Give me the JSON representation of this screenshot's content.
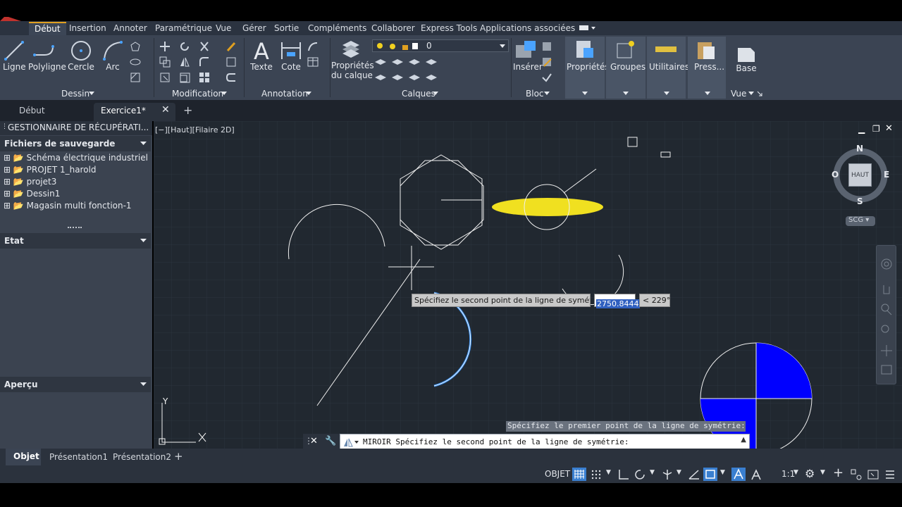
{
  "menu": {
    "items": [
      "Début",
      "Insertion",
      "Annoter",
      "Paramétrique",
      "Vue",
      "Gérer",
      "Sortie",
      "Compléments",
      "Collaborer",
      "Express Tools",
      "Applications associées"
    ]
  },
  "ribbon": {
    "tools": {
      "ligne": "Ligne",
      "polyligne": "Polyligne",
      "cercle": "Cercle",
      "arc": "Arc",
      "texte": "Texte",
      "cote": "Cote",
      "proprietes_calque_1": "Propriétés",
      "proprietes_calque_2": "du calque",
      "inserer": "Insérer",
      "proprietes": "Propriétés",
      "groupes": "Groupes",
      "utilitaires": "Utilitaires",
      "press": "Press...",
      "base": "Base"
    },
    "panels": {
      "dessin": "Dessin",
      "modification": "Modification",
      "annotation": "Annotation",
      "calques": "Calques",
      "bloc": "Bloc",
      "vue": "Vue"
    },
    "layer_value": "0"
  },
  "doc_tabs": {
    "debut": "Début",
    "exercice": "Exercice1*"
  },
  "left_panel": {
    "title": "GESTIONNAIRE DE RÉCUPÉRATI...",
    "section_files": "Fichiers de sauvegarde",
    "files": [
      "Schéma électrique industriel",
      "PROJET 1_harold",
      "projet3",
      "Dessin1",
      "Magasin multi fonction-1"
    ],
    "section_state": "Etat",
    "section_preview": "Aperçu"
  },
  "viewport": {
    "label": "[−][Haut][Filaire 2D]",
    "compass": {
      "n": "N",
      "s": "S",
      "e": "E",
      "o": "O",
      "center": "HAUT"
    },
    "scg": "SCG",
    "tooltip": "Spécifiez le second point de la ligne de symétrie:",
    "input_value": "2750.8444",
    "angle": "< 229°",
    "axis_y": "Y",
    "history_line": "Spécifiez le premier point de la ligne de symétrie:"
  },
  "command": {
    "prompt": "MIROIR Spécifiez le second point de la ligne de symétrie:"
  },
  "layout_tabs": {
    "objet": "Objet",
    "pres1": "Présentation1",
    "pres2": "Présentation2"
  },
  "status": {
    "objet": "OBJET",
    "scale": "1:1"
  },
  "colors": {
    "accent": "#e0a020",
    "yellow": "#f0e020",
    "blue": "#0000ff",
    "cursor_blue": "#3b8eea"
  }
}
